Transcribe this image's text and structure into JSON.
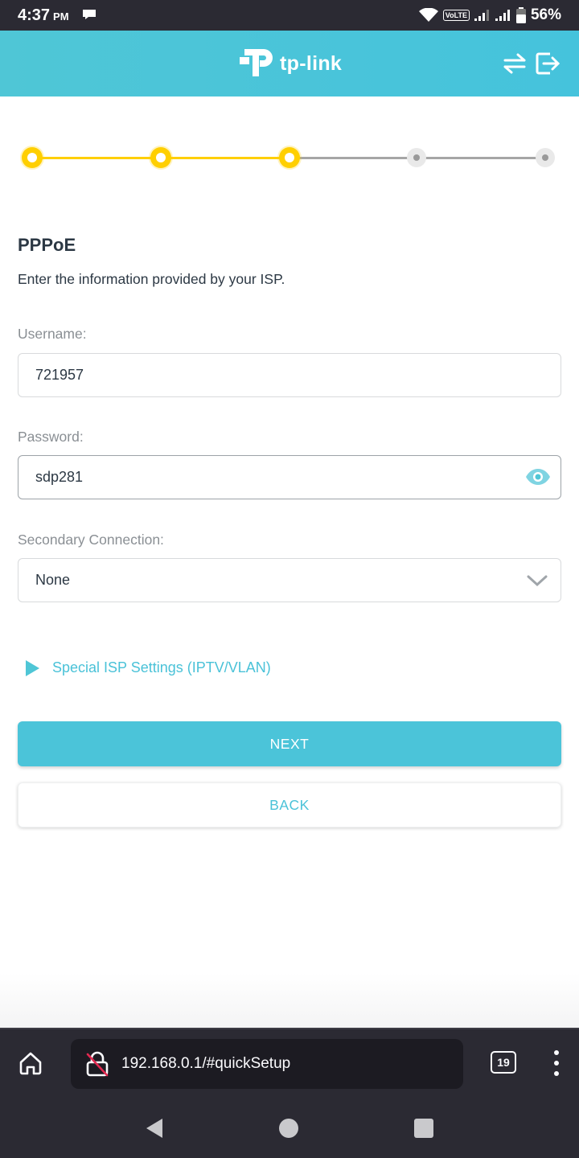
{
  "status_bar": {
    "time": "4:37",
    "ampm": "PM",
    "network": "VoLTE",
    "battery": "56%"
  },
  "header": {
    "brand": "tp-link",
    "colors": {
      "accent": "#4bc4d9",
      "progress": "#ffcf00"
    }
  },
  "progress": {
    "total_steps": 5,
    "completed_steps": 3
  },
  "main": {
    "title": "PPPoE",
    "description": "Enter the information provided by your ISP.",
    "username": {
      "label": "Username:",
      "value": "721957"
    },
    "password": {
      "label": "Password:",
      "value": "sdp281"
    },
    "secondary": {
      "label": "Secondary Connection:",
      "value": "None"
    },
    "special_isp": "Special ISP Settings (IPTV/VLAN)",
    "next_label": "NEXT",
    "back_label": "BACK"
  },
  "browser": {
    "url": "192.168.0.1/#quickSetup",
    "tab_count": "19"
  },
  "icons": [
    "home-icon",
    "insecure-lock-icon",
    "tabs-icon",
    "menu-icon",
    "eye-icon",
    "chevron-down-icon",
    "switch-icon",
    "logout-icon"
  ]
}
